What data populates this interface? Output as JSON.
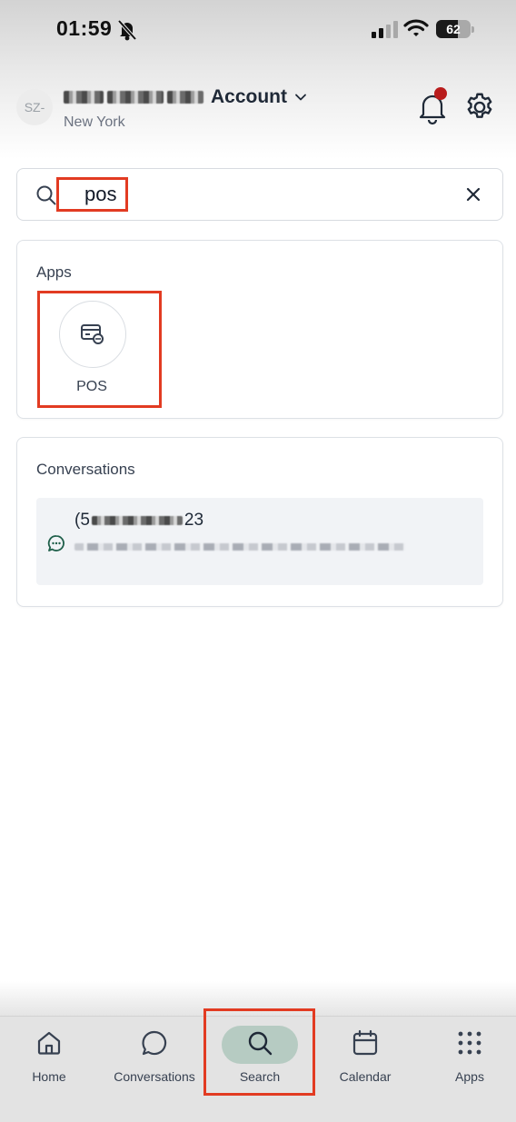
{
  "status_bar": {
    "time": "01:59",
    "battery": "62",
    "battery_level": 0.62
  },
  "header": {
    "avatar_text": "SZ-",
    "account_label": "Account",
    "location": "New York",
    "icons": [
      "chevron-down-icon",
      "bell-icon",
      "gear-icon"
    ]
  },
  "search": {
    "value": "pos"
  },
  "apps_section": {
    "title": "Apps",
    "items": [
      {
        "label": "POS",
        "icon": "pos-register-icon"
      }
    ]
  },
  "conversations_section": {
    "title": "Conversations",
    "items": [
      {
        "phone_start": "(5",
        "phone_end": "23"
      }
    ]
  },
  "tab_bar": {
    "tabs": [
      {
        "label": "Home",
        "icon": "home-icon"
      },
      {
        "label": "Conversations",
        "icon": "chat-bubble-icon"
      },
      {
        "label": "Search",
        "icon": "search-icon",
        "active": true
      },
      {
        "label": "Calendar",
        "icon": "calendar-icon"
      },
      {
        "label": "Apps",
        "icon": "grid-icon"
      }
    ]
  },
  "colors": {
    "highlight": "#e23b22",
    "active_tab_pill": "#b6cbc2",
    "notification_dot": "#b91c1c"
  }
}
